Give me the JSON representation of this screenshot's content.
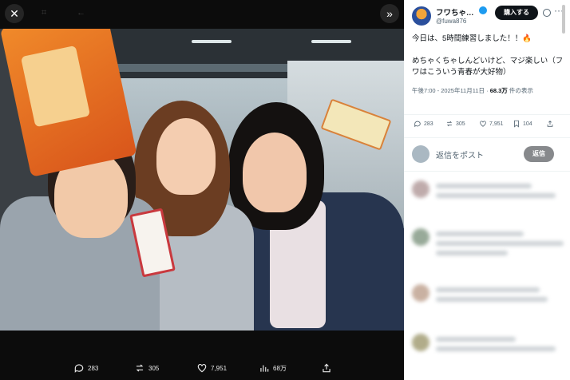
{
  "viewer": {
    "close_icon": "close-icon",
    "collapse_icon": "chevron-double-right-icon",
    "actions": {
      "replies": "283",
      "reposts": "305",
      "likes": "7,951",
      "views": "68万"
    }
  },
  "author": {
    "name": "フワちゃ…",
    "handle": "@fuwa876",
    "subscribe_label": "購入する"
  },
  "tweet": {
    "line1": "今日は、5時間練習しました！！🔥",
    "line2": "めちゃくちゃしんどいけど、マジ楽しい（フワはこういう青春が大好物）",
    "meta_time": "午後7:00 - 2025年11月11日 · ",
    "meta_views_count": "68.3万",
    "meta_views_label": " 件の表示"
  },
  "stats": {
    "replies": "283",
    "reposts": "305",
    "likes": "7,951",
    "bookmarks": "104"
  },
  "reply": {
    "placeholder": "返信をポスト",
    "button_label": "返信"
  },
  "colors": {
    "verified": "#1d9bf0",
    "text": "#0f1419",
    "secondary": "#536471"
  }
}
